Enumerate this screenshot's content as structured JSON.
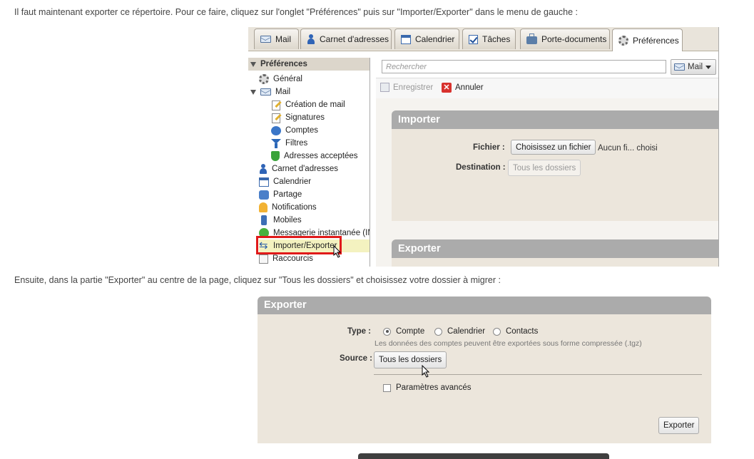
{
  "intro_text": "Il faut maintenant exporter ce répertoire. Pour ce faire, cliquez sur l'onglet \"Préférences\" puis sur \"Importer/Exporter\" dans le menu de gauche :",
  "second_text": "Ensuite, dans la partie \"Exporter\" au centre de la page, cliquez sur \"Tous les dossiers\" et choisissez votre dossier à migrer :",
  "screenshot1": {
    "tabs": [
      {
        "label": "Mail",
        "icon": "mail-icon"
      },
      {
        "label": "Carnet d'adresses",
        "icon": "contacts-icon"
      },
      {
        "label": "Calendrier",
        "icon": "calendar-icon"
      },
      {
        "label": "Tâches",
        "icon": "tasks-icon"
      },
      {
        "label": "Porte-documents",
        "icon": "briefcase-icon"
      },
      {
        "label": "Préférences",
        "icon": "gear-icon",
        "active": true
      }
    ],
    "sidebar": {
      "header": "Préférences",
      "items": [
        {
          "label": "Général",
          "icon": "gear-icon"
        },
        {
          "label": "Mail",
          "icon": "mail-icon",
          "expanded": true
        },
        {
          "label": "Création de mail",
          "icon": "compose-icon"
        },
        {
          "label": "Signatures",
          "icon": "signature-icon"
        },
        {
          "label": "Comptes",
          "icon": "accounts-icon"
        },
        {
          "label": "Filtres",
          "icon": "filter-icon"
        },
        {
          "label": "Adresses acceptées",
          "icon": "shield-icon"
        },
        {
          "label": "Carnet d'adresses",
          "icon": "contacts-icon"
        },
        {
          "label": "Calendrier",
          "icon": "calendar-icon"
        },
        {
          "label": "Partage",
          "icon": "share-icon"
        },
        {
          "label": "Notifications",
          "icon": "bell-icon"
        },
        {
          "label": "Mobiles",
          "icon": "mobile-icon"
        },
        {
          "label": "Messagerie instantanée (IM",
          "icon": "chat-icon"
        },
        {
          "label": "Importer/Exporter",
          "icon": "import-export-icon",
          "selected": true
        },
        {
          "label": "Raccourcis",
          "icon": "shortcuts-icon"
        }
      ]
    },
    "search": {
      "placeholder": "Rechercher",
      "scope_label": "Mail"
    },
    "toolbar": {
      "save_label": "Enregistrer",
      "cancel_label": "Annuler"
    },
    "importer": {
      "title": "Importer",
      "file_label": "Fichier :",
      "file_button": "Choisissez un fichier",
      "file_status": "Aucun fi... choisi",
      "destination_label": "Destination :",
      "destination_value": "Tous les dossiers"
    },
    "exporter_title": "Exporter",
    "highlight_color": "#e01a1a"
  },
  "screenshot2": {
    "title": "Exporter",
    "type_label": "Type :",
    "type_options": [
      "Compte",
      "Calendrier",
      "Contacts"
    ],
    "type_selected": "Compte",
    "hint": "Les données des comptes peuvent être exportées sous forme compressée (.tgz)",
    "source_label": "Source :",
    "source_button": "Tous les dossiers",
    "advanced_label": "Paramètres avancés",
    "export_button": "Exporter"
  }
}
